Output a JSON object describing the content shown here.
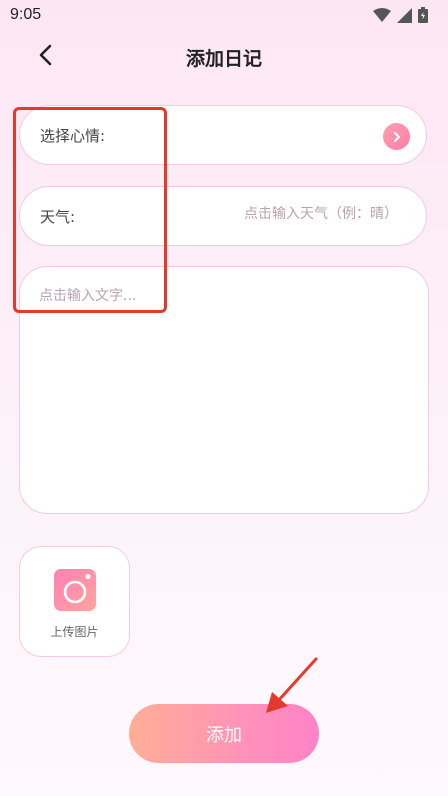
{
  "status_bar": {
    "time": "9:05"
  },
  "header": {
    "title": "添加日记"
  },
  "form": {
    "mood_label": "选择心情:",
    "weather_label": "天气:",
    "weather_placeholder": "点击输入天气（例：晴）",
    "weather_value": "",
    "content_placeholder": "点击输入文字...",
    "content_value": ""
  },
  "upload": {
    "label": "上传图片"
  },
  "submit": {
    "label": "添加"
  },
  "colors": {
    "accent_start": "#ffae96",
    "accent_end": "#ff82c8",
    "field_border": "#f3c9e3",
    "annotation": "#e43a2e"
  },
  "icons": {
    "back": "chevron-left-icon",
    "mood": "chevron-right-icon",
    "upload": "camera-icon",
    "status": [
      "wifi-icon",
      "signal-icon",
      "battery-icon"
    ]
  }
}
